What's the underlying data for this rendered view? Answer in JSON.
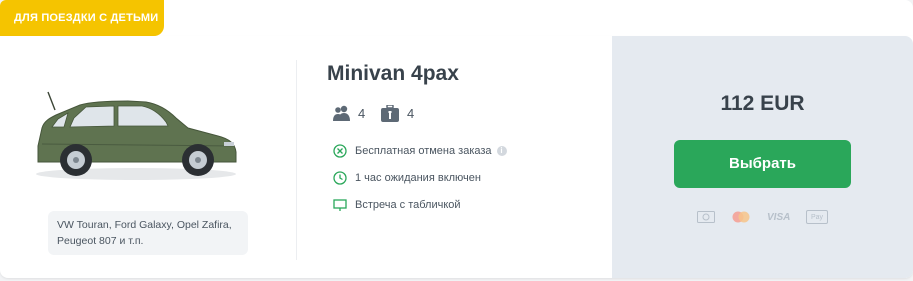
{
  "badge": {
    "label": "ДЛЯ ПОЕЗДКИ С ДЕТЬМИ"
  },
  "vehicle": {
    "title": "Minivan 4pax",
    "passengers": "4",
    "luggage": "4",
    "models_line1": "VW Touran, Ford Galaxy, Opel Zafira,",
    "models_line2": "Peugeot 807 и т.п.",
    "car_color": "#5f7350"
  },
  "features": [
    {
      "icon": "cancel-circle-icon",
      "label": "Бесплатная отмена заказа"
    },
    {
      "icon": "clock-icon",
      "label": "1 час ожидания включен"
    },
    {
      "icon": "sign-board-icon",
      "label": "Встреча с табличкой"
    }
  ],
  "price": {
    "amount": "112 EUR"
  },
  "select_button": {
    "label": "Выбрать",
    "color": "#2aa75a"
  },
  "payment_methods": [
    "cash-icon",
    "mastercard-icon",
    "VISA",
    "apple-pay-icon"
  ],
  "apple_pay_label": "Pay",
  "colors": {
    "badge": "#f5c400",
    "price_panel": "#e5eaf0",
    "icon_green": "#2aa75a",
    "text": "#38424b"
  }
}
